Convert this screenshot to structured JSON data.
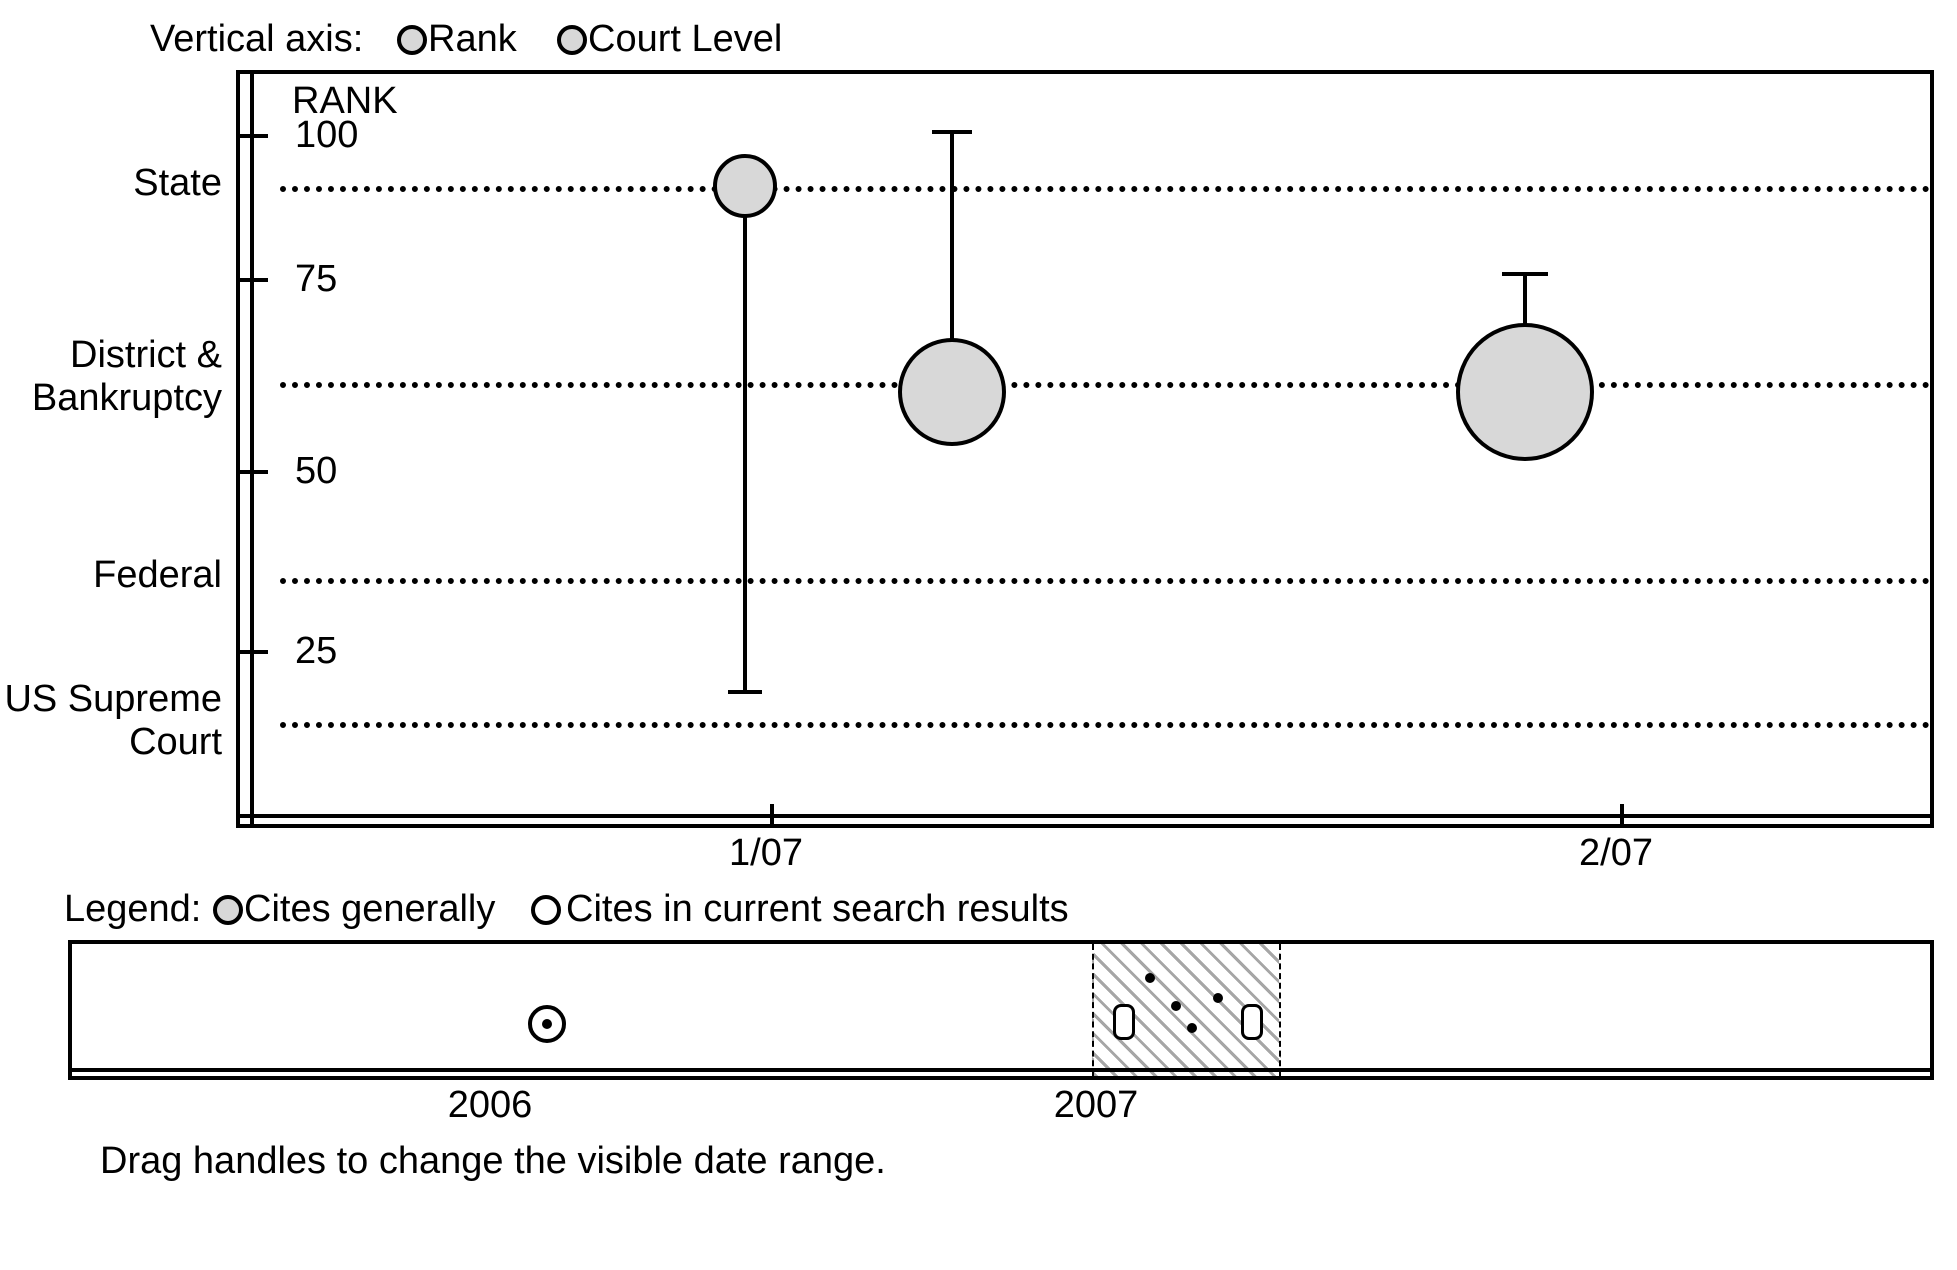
{
  "vaxis": {
    "prefix": "Vertical axis:",
    "opt_rank": "Rank",
    "opt_court": "Court Level"
  },
  "rank_axis_title": "RANK",
  "rank_ticks": {
    "t100": "100",
    "t75": "75",
    "t50": "50",
    "t25": "25"
  },
  "court_levels": {
    "state": "State",
    "district": "District &\nBankruptcy",
    "federal": "Federal",
    "ussc": "US Supreme\nCourt"
  },
  "x_ticks": {
    "x1": "1/07",
    "x2": "2/07"
  },
  "legend": {
    "prefix": "Legend:",
    "cg": "Cites generally",
    "cr": "Cites in current search results"
  },
  "timeline": {
    "t2006": "2006",
    "t2007": "2007"
  },
  "hint": "Drag handles to change the visible date range.",
  "chart_data": {
    "type": "scatter",
    "title": "",
    "xlabel": "",
    "ylabel": "RANK",
    "y_axes": {
      "rank": {
        "label": "RANK",
        "range": [
          0,
          100
        ],
        "ticks": [
          25,
          50,
          75,
          100
        ]
      },
      "court_level": {
        "categories": [
          "US Supreme Court",
          "Federal",
          "District & Bankruptcy",
          "State"
        ]
      }
    },
    "x_ticks": [
      "1/07",
      "2/07"
    ],
    "series": [
      {
        "name": "Cites",
        "points": [
          {
            "x": "1/07",
            "court_level": "State",
            "rank_low": 17,
            "rank_high": 98,
            "size": 1
          },
          {
            "x": "1/07",
            "court_level": "District & Bankruptcy",
            "rank_low": 60,
            "rank_high": 100,
            "size": 2,
            "x_offset_days": 5
          },
          {
            "x": "2/07",
            "court_level": "District & Bankruptcy",
            "rank_low": 60,
            "rank_high": 75,
            "size": 3,
            "x_offset_days": -7
          }
        ]
      }
    ],
    "timeline_range": [
      "2006",
      "2008"
    ],
    "timeline_visible_window": [
      "2007-01",
      "2007-02"
    ],
    "timeline_events": [
      {
        "x": "2006-03",
        "kind": "search_result"
      },
      {
        "x": "2007-01",
        "kind": "cluster"
      },
      {
        "x": "2007-01",
        "kind": "general"
      },
      {
        "x": "2007-01",
        "kind": "general"
      },
      {
        "x": "2007-02",
        "kind": "cluster"
      },
      {
        "x": "2007-01",
        "kind": "general"
      }
    ]
  }
}
